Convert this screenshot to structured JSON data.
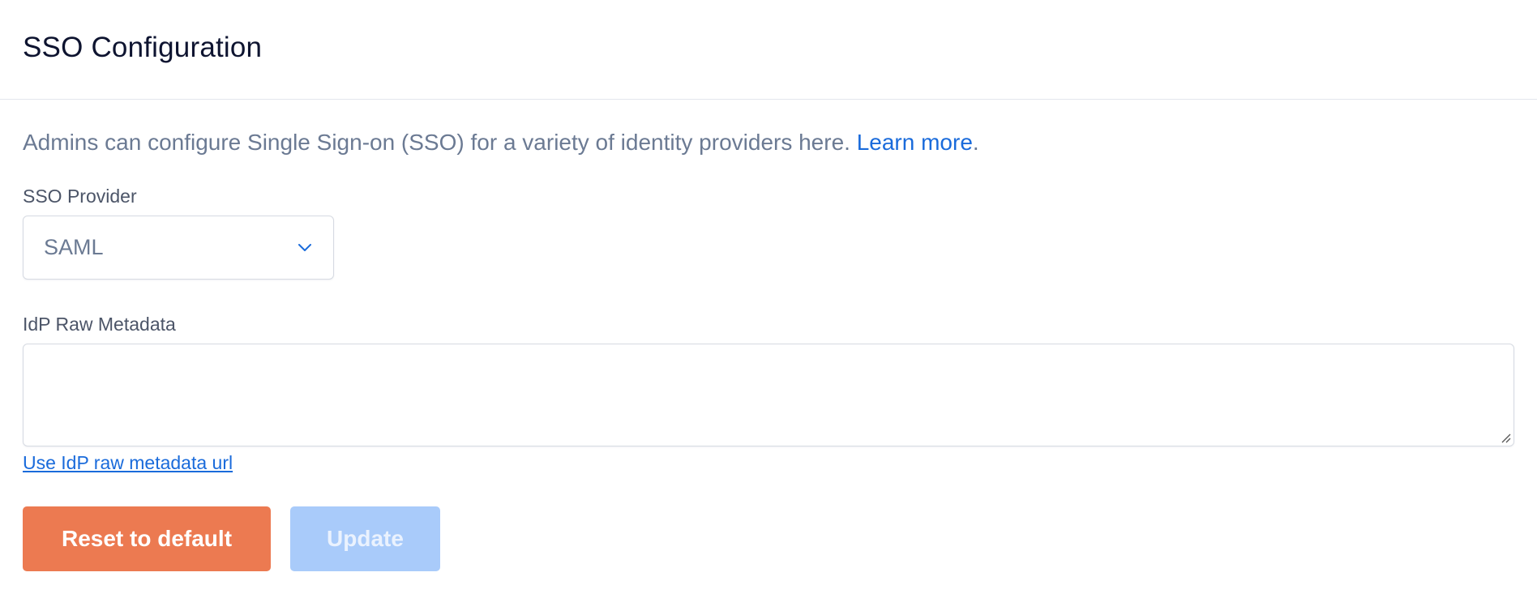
{
  "header": {
    "title": "SSO Configuration"
  },
  "description": {
    "text": "Admins can configure Single Sign-on (SSO) for a variety of identity providers here. ",
    "link_label": "Learn more",
    "suffix": "."
  },
  "provider": {
    "label": "SSO Provider",
    "selected": "SAML",
    "icon": "chevron-down-icon"
  },
  "metadata": {
    "label": "IdP Raw Metadata",
    "value": "",
    "link_label": "Use IdP raw metadata url"
  },
  "actions": {
    "reset_label": "Reset to default",
    "update_label": "Update"
  },
  "colors": {
    "accent_link": "#1a6bdb",
    "reset_button": "#ec7a51",
    "update_button_disabled": "#a9cbfa"
  }
}
